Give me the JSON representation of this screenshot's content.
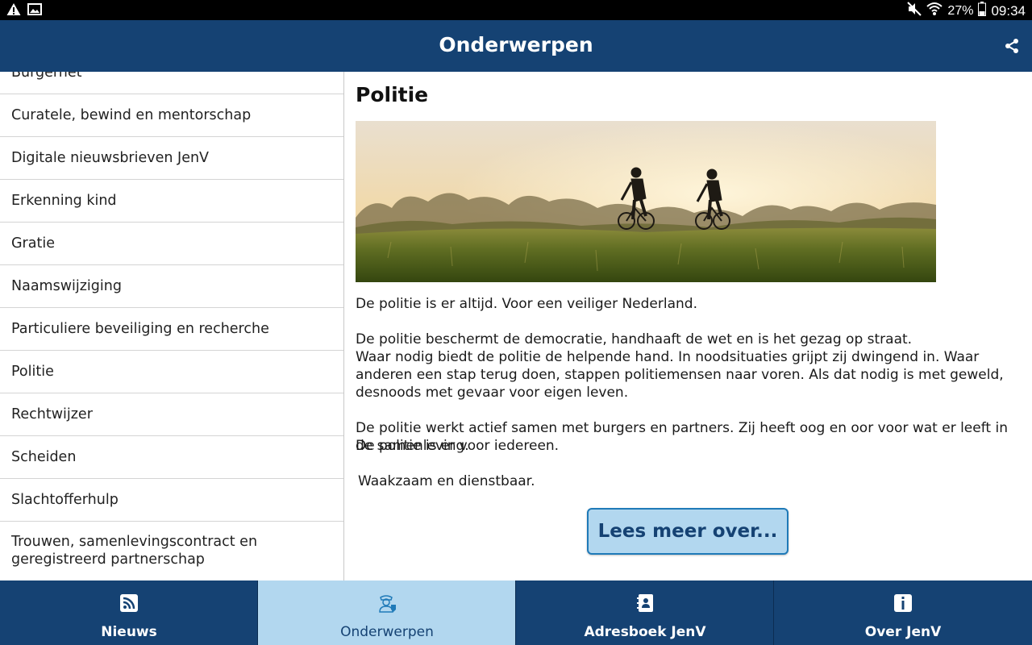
{
  "status_bar": {
    "battery": "27%",
    "time": "09:34",
    "icons": [
      "warning-icon",
      "image-icon",
      "mute-icon",
      "wifi-icon",
      "battery-icon"
    ]
  },
  "header": {
    "title": "Onderwerpen",
    "share_icon": "share-icon"
  },
  "sidebar": {
    "items": [
      {
        "label": "Burgernet"
      },
      {
        "label": "Curatele, bewind en mentorschap"
      },
      {
        "label": "Digitale nieuwsbrieven JenV"
      },
      {
        "label": "Erkenning kind"
      },
      {
        "label": "Gratie"
      },
      {
        "label": "Naamswijziging"
      },
      {
        "label": "Particuliere beveiliging en recherche"
      },
      {
        "label": "Politie"
      },
      {
        "label": "Rechtwijzer"
      },
      {
        "label": "Scheiden"
      },
      {
        "label": "Slachtofferhulp"
      },
      {
        "label": "Trouwen, samenlevingscontract en geregistreerd partnerschap"
      }
    ]
  },
  "article": {
    "title": "Politie",
    "paragraphs": [
      "De politie is er altijd. Voor een veiliger Nederland.",
      "De politie beschermt de democratie, handhaaft de wet en is het gezag op straat.",
      "Waar nodig biedt de politie de helpende hand. In noodsituaties grijpt zij dwingend in. Waar anderen een stap terug doen, stappen politiemensen naar voren. Als dat nodig is met geweld, desnoods met gevaar voor eigen leven.",
      "De politie werkt actief samen met burgers en partners. Zij heeft oog en oor voor wat er leeft in de samenleving.",
      "De politie is er voor iedereen.",
      "Waakzaam en dienstbaar."
    ],
    "more_button": "Lees meer over..."
  },
  "bottom_nav": {
    "tabs": [
      {
        "label": "Nieuws",
        "icon": "rss-icon"
      },
      {
        "label": "Onderwerpen",
        "icon": "officer-icon"
      },
      {
        "label": "Adresboek JenV",
        "icon": "address-book-icon"
      },
      {
        "label": "Over JenV",
        "icon": "info-icon"
      }
    ],
    "active": "Onderwerpen"
  },
  "colors": {
    "primary": "#154273",
    "accent_light": "#b2d7ef",
    "button_border": "#1f7ab8"
  }
}
